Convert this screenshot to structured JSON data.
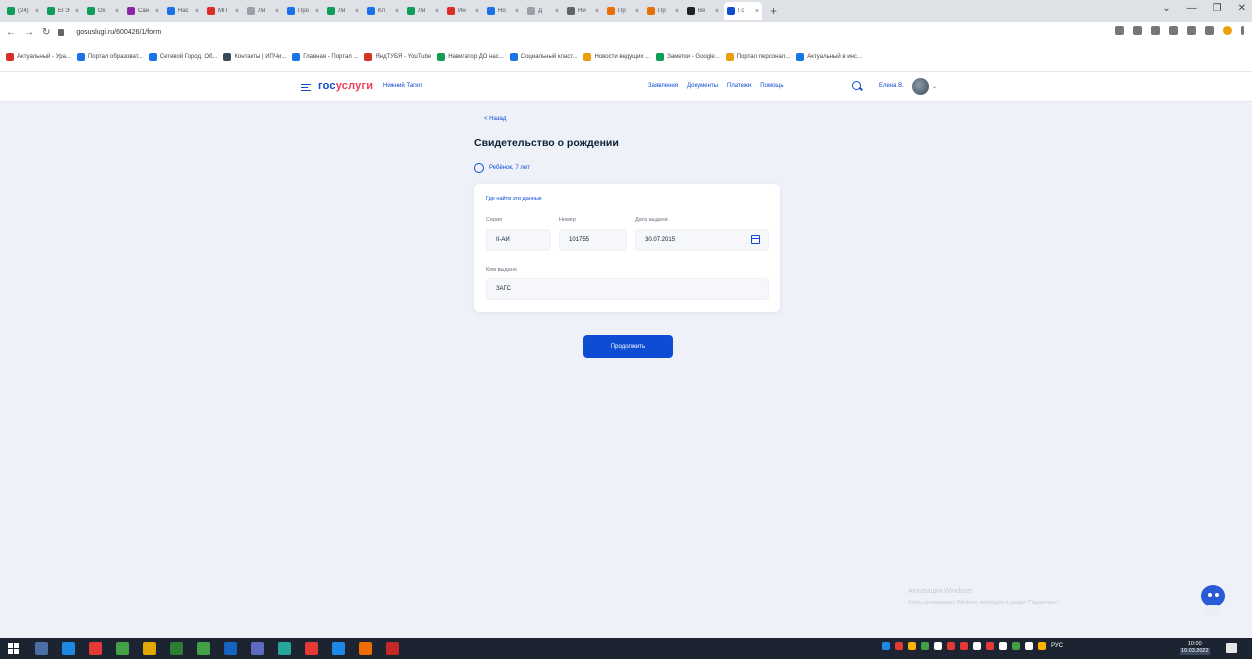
{
  "browser": {
    "tabs": [
      {
        "title": "(24)",
        "color": "#0f9d58"
      },
      {
        "title": "ЕГЭ",
        "color": "#0f9d58"
      },
      {
        "title": "Ох",
        "color": "#0f9d58"
      },
      {
        "title": "Сан",
        "color": "#8e24aa"
      },
      {
        "title": "Нас",
        "color": "#1a73e8"
      },
      {
        "title": "МП",
        "color": "#d93025"
      },
      {
        "title": "Ли",
        "color": "#9aa0a6"
      },
      {
        "title": "Про",
        "color": "#1a73e8"
      },
      {
        "title": "Ли",
        "color": "#0f9d58"
      },
      {
        "title": "Кл",
        "color": "#1a73e8"
      },
      {
        "title": "Ли",
        "color": "#0f9d58"
      },
      {
        "title": "Ин",
        "color": "#d93025"
      },
      {
        "title": "Но",
        "color": "#1a73e8"
      },
      {
        "title": "Д",
        "color": "#9aa0a6"
      },
      {
        "title": "Ни",
        "color": "#5f6368"
      },
      {
        "title": "Пр",
        "color": "#e8710a"
      },
      {
        "title": "Пр",
        "color": "#e8710a"
      },
      {
        "title": "Ве",
        "color": "#202124"
      },
      {
        "title": "Гс",
        "color": "#0d4cd3"
      }
    ],
    "new_tab_symbol": "+",
    "window_controls": [
      "⌄",
      "—",
      "❐",
      "✕"
    ],
    "nav": {
      "back": "←",
      "forward": "→",
      "reload": "↻"
    },
    "url": "gosuslugi.ru/600426/1/form",
    "bookmarks": [
      {
        "label": "Актуальный - Ура...",
        "color": "#d93025"
      },
      {
        "label": "Портал образоват...",
        "color": "#1a73e8"
      },
      {
        "label": "Сетевой Город. Об...",
        "color": "#1a73e8"
      },
      {
        "label": "Контакты | ИПЧи...",
        "color": "#3c4a57"
      },
      {
        "label": "Главная - Портал ...",
        "color": "#1a73e8"
      },
      {
        "label": "ЯндТУБЯ - YouTube",
        "color": "#d93025"
      },
      {
        "label": "Навигатор ДО нас...",
        "color": "#0f9d58"
      },
      {
        "label": "Социальный класт...",
        "color": "#1a73e8"
      },
      {
        "label": "Новости ведущих ...",
        "color": "#e8a00a"
      },
      {
        "label": "Заметки - Google...",
        "color": "#0f9d58"
      },
      {
        "label": "Портал персонал...",
        "color": "#e8a00a"
      },
      {
        "label": "Актуальный в инс...",
        "color": "#1a73e8"
      }
    ]
  },
  "header": {
    "logo_gos": "гос",
    "logo_usl": "услуги",
    "location": "Нижний Тагил",
    "nav": [
      "Заявления",
      "Документы",
      "Платежи",
      "Помощь"
    ],
    "user": "Елена В."
  },
  "page": {
    "back": "< Назад",
    "title": "Свидетельство о рождении",
    "person": "Ребёнок, 7 лет",
    "help_link": "Где найти эти данные",
    "fields": {
      "series_label": "Серия",
      "series_value": "II-АИ",
      "number_label": "Номер",
      "number_value": "101755",
      "date_label": "Дата выдачи",
      "date_value": "30.07.2015",
      "issuer_label": "Кем выдано",
      "issuer_value": "ЗАГС"
    },
    "continue_label": "Продолжить"
  },
  "watermark": {
    "title": "Активация Windows",
    "subtitle": "Чтобы активировать Windows, перейдите в раздел \"Параметры\"."
  },
  "taskbar": {
    "apps": [
      {
        "color": "#4a6fa5"
      },
      {
        "color": "#1e88e5"
      },
      {
        "color": "#e53935"
      },
      {
        "color": "#43a047"
      },
      {
        "color": "#e0a800"
      },
      {
        "color": "#2e7d32"
      },
      {
        "color": "#43a047"
      },
      {
        "color": "#1565c0"
      },
      {
        "color": "#5c6bc0"
      },
      {
        "color": "#26a69a"
      },
      {
        "color": "#e53935"
      },
      {
        "color": "#1e88e5"
      },
      {
        "color": "#ef6c00"
      },
      {
        "color": "#c62828"
      }
    ],
    "tray_colors": [
      "#1e88e5",
      "#e53935",
      "#ffb300",
      "#43a047",
      "#ffffff",
      "#e53935",
      "#e53935",
      "#ffffff",
      "#e53935",
      "#ffffff",
      "#43a047",
      "#ffffff",
      "#ffb300"
    ],
    "lang": "РУС",
    "time": "10:00",
    "date": "10.03.2022"
  }
}
